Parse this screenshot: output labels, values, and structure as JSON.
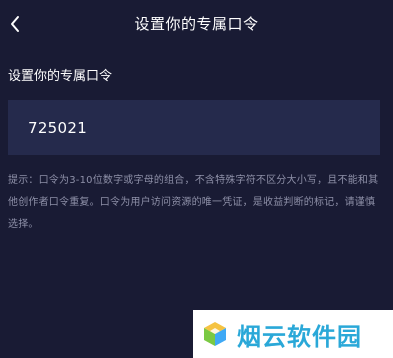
{
  "nav": {
    "title": "设置你的专属口令",
    "back_icon": "chevron-left-icon"
  },
  "form": {
    "label": "设置你的专属口令",
    "code_value": "725021",
    "hint": "提示：口令为3-10位数字或字母的组合，不含特殊字符不区分大小写，且不能和其他创作者口令重复。口令为用户访问资源的唯一凭证，是收益判断的标记，请谨慎选择。"
  },
  "watermark": {
    "text": "烟云软件园",
    "logo_icon": "cube-logo-icon"
  },
  "colors": {
    "background": "#191b34",
    "input_background": "#252a4c",
    "hint_text": "#8e90a8",
    "watermark_text": "#2aa8d8"
  }
}
